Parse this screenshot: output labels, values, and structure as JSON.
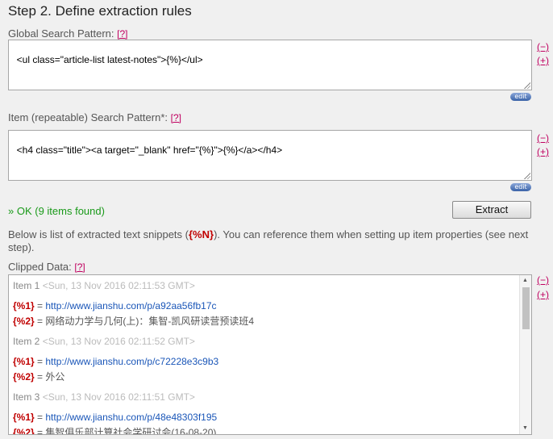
{
  "page_title": "Step 2. Define extraction rules",
  "help_label": "[?]",
  "collapse_label": "(−)",
  "expand_label": "(+)",
  "edit_label": "edit",
  "global_pattern": {
    "label": "Global Search Pattern:",
    "value": "<ul class=\"article-list latest-notes\">{%}</ul>"
  },
  "item_pattern": {
    "label": "Item (repeatable) Search Pattern*:",
    "value": "<h4 class=\"title\"><a target=\"_blank\" href=\"{%}\">{%}</a></h4>"
  },
  "status": {
    "ok_text": "» OK (9 items found)"
  },
  "extract_button": "Extract",
  "description": {
    "before": "Below is list of extracted text snippets (",
    "var": "{%N}",
    "after": "). You can reference them when setting up item properties (see next step)."
  },
  "clipped": {
    "label": "Clipped Data:",
    "items": [
      {
        "name": "Item 1",
        "date": "<Sun, 13 Nov 2016 02:11:53 GMT>",
        "v1_key": "{%1}",
        "eq": " = ",
        "v1": "http://www.jianshu.com/p/a92aa56fb17c",
        "v2_key": "{%2}",
        "v2": "网络动力学与几何(上)：集智-凯风研读营预读班4"
      },
      {
        "name": "Item 2",
        "date": "<Sun, 13 Nov 2016 02:11:52 GMT>",
        "v1_key": "{%1}",
        "eq": " = ",
        "v1": "http://www.jianshu.com/p/c72228e3c9b3",
        "v2_key": "{%2}",
        "v2": "外公"
      },
      {
        "name": "Item 3",
        "date": "<Sun, 13 Nov 2016 02:11:51 GMT>",
        "v1_key": "{%1}",
        "eq": " = ",
        "v1": "http://www.jianshu.com/p/48e48303f195",
        "v2_key": "{%2}",
        "v2": "集智俱乐部计算社会学研讨会(16-08-20)"
      }
    ]
  }
}
